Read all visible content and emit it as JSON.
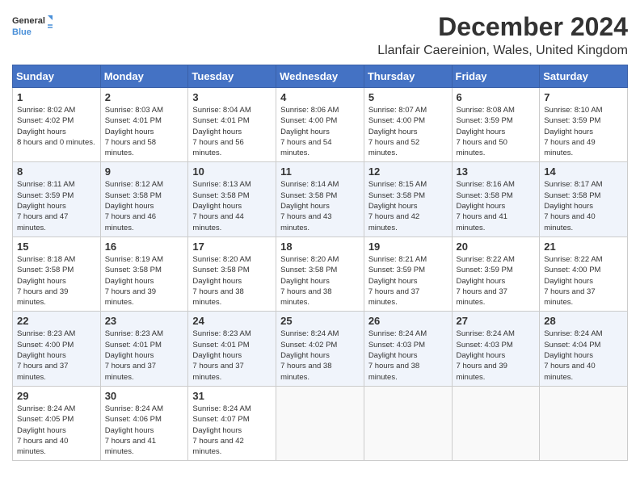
{
  "logo": {
    "line1": "General",
    "line2": "Blue"
  },
  "title": "December 2024",
  "subtitle": "Llanfair Caereinion, Wales, United Kingdom",
  "headers": [
    "Sunday",
    "Monday",
    "Tuesday",
    "Wednesday",
    "Thursday",
    "Friday",
    "Saturday"
  ],
  "weeks": [
    [
      {
        "day": "1",
        "sunrise": "8:02 AM",
        "sunset": "4:02 PM",
        "daylight": "8 hours and 0 minutes."
      },
      {
        "day": "2",
        "sunrise": "8:03 AM",
        "sunset": "4:01 PM",
        "daylight": "7 hours and 58 minutes."
      },
      {
        "day": "3",
        "sunrise": "8:04 AM",
        "sunset": "4:01 PM",
        "daylight": "7 hours and 56 minutes."
      },
      {
        "day": "4",
        "sunrise": "8:06 AM",
        "sunset": "4:00 PM",
        "daylight": "7 hours and 54 minutes."
      },
      {
        "day": "5",
        "sunrise": "8:07 AM",
        "sunset": "4:00 PM",
        "daylight": "7 hours and 52 minutes."
      },
      {
        "day": "6",
        "sunrise": "8:08 AM",
        "sunset": "3:59 PM",
        "daylight": "7 hours and 50 minutes."
      },
      {
        "day": "7",
        "sunrise": "8:10 AM",
        "sunset": "3:59 PM",
        "daylight": "7 hours and 49 minutes."
      }
    ],
    [
      {
        "day": "8",
        "sunrise": "8:11 AM",
        "sunset": "3:59 PM",
        "daylight": "7 hours and 47 minutes."
      },
      {
        "day": "9",
        "sunrise": "8:12 AM",
        "sunset": "3:58 PM",
        "daylight": "7 hours and 46 minutes."
      },
      {
        "day": "10",
        "sunrise": "8:13 AM",
        "sunset": "3:58 PM",
        "daylight": "7 hours and 44 minutes."
      },
      {
        "day": "11",
        "sunrise": "8:14 AM",
        "sunset": "3:58 PM",
        "daylight": "7 hours and 43 minutes."
      },
      {
        "day": "12",
        "sunrise": "8:15 AM",
        "sunset": "3:58 PM",
        "daylight": "7 hours and 42 minutes."
      },
      {
        "day": "13",
        "sunrise": "8:16 AM",
        "sunset": "3:58 PM",
        "daylight": "7 hours and 41 minutes."
      },
      {
        "day": "14",
        "sunrise": "8:17 AM",
        "sunset": "3:58 PM",
        "daylight": "7 hours and 40 minutes."
      }
    ],
    [
      {
        "day": "15",
        "sunrise": "8:18 AM",
        "sunset": "3:58 PM",
        "daylight": "7 hours and 39 minutes."
      },
      {
        "day": "16",
        "sunrise": "8:19 AM",
        "sunset": "3:58 PM",
        "daylight": "7 hours and 39 minutes."
      },
      {
        "day": "17",
        "sunrise": "8:20 AM",
        "sunset": "3:58 PM",
        "daylight": "7 hours and 38 minutes."
      },
      {
        "day": "18",
        "sunrise": "8:20 AM",
        "sunset": "3:58 PM",
        "daylight": "7 hours and 38 minutes."
      },
      {
        "day": "19",
        "sunrise": "8:21 AM",
        "sunset": "3:59 PM",
        "daylight": "7 hours and 37 minutes."
      },
      {
        "day": "20",
        "sunrise": "8:22 AM",
        "sunset": "3:59 PM",
        "daylight": "7 hours and 37 minutes."
      },
      {
        "day": "21",
        "sunrise": "8:22 AM",
        "sunset": "4:00 PM",
        "daylight": "7 hours and 37 minutes."
      }
    ],
    [
      {
        "day": "22",
        "sunrise": "8:23 AM",
        "sunset": "4:00 PM",
        "daylight": "7 hours and 37 minutes."
      },
      {
        "day": "23",
        "sunrise": "8:23 AM",
        "sunset": "4:01 PM",
        "daylight": "7 hours and 37 minutes."
      },
      {
        "day": "24",
        "sunrise": "8:23 AM",
        "sunset": "4:01 PM",
        "daylight": "7 hours and 37 minutes."
      },
      {
        "day": "25",
        "sunrise": "8:24 AM",
        "sunset": "4:02 PM",
        "daylight": "7 hours and 38 minutes."
      },
      {
        "day": "26",
        "sunrise": "8:24 AM",
        "sunset": "4:03 PM",
        "daylight": "7 hours and 38 minutes."
      },
      {
        "day": "27",
        "sunrise": "8:24 AM",
        "sunset": "4:03 PM",
        "daylight": "7 hours and 39 minutes."
      },
      {
        "day": "28",
        "sunrise": "8:24 AM",
        "sunset": "4:04 PM",
        "daylight": "7 hours and 40 minutes."
      }
    ],
    [
      {
        "day": "29",
        "sunrise": "8:24 AM",
        "sunset": "4:05 PM",
        "daylight": "7 hours and 40 minutes."
      },
      {
        "day": "30",
        "sunrise": "8:24 AM",
        "sunset": "4:06 PM",
        "daylight": "7 hours and 41 minutes."
      },
      {
        "day": "31",
        "sunrise": "8:24 AM",
        "sunset": "4:07 PM",
        "daylight": "7 hours and 42 minutes."
      },
      null,
      null,
      null,
      null
    ]
  ]
}
